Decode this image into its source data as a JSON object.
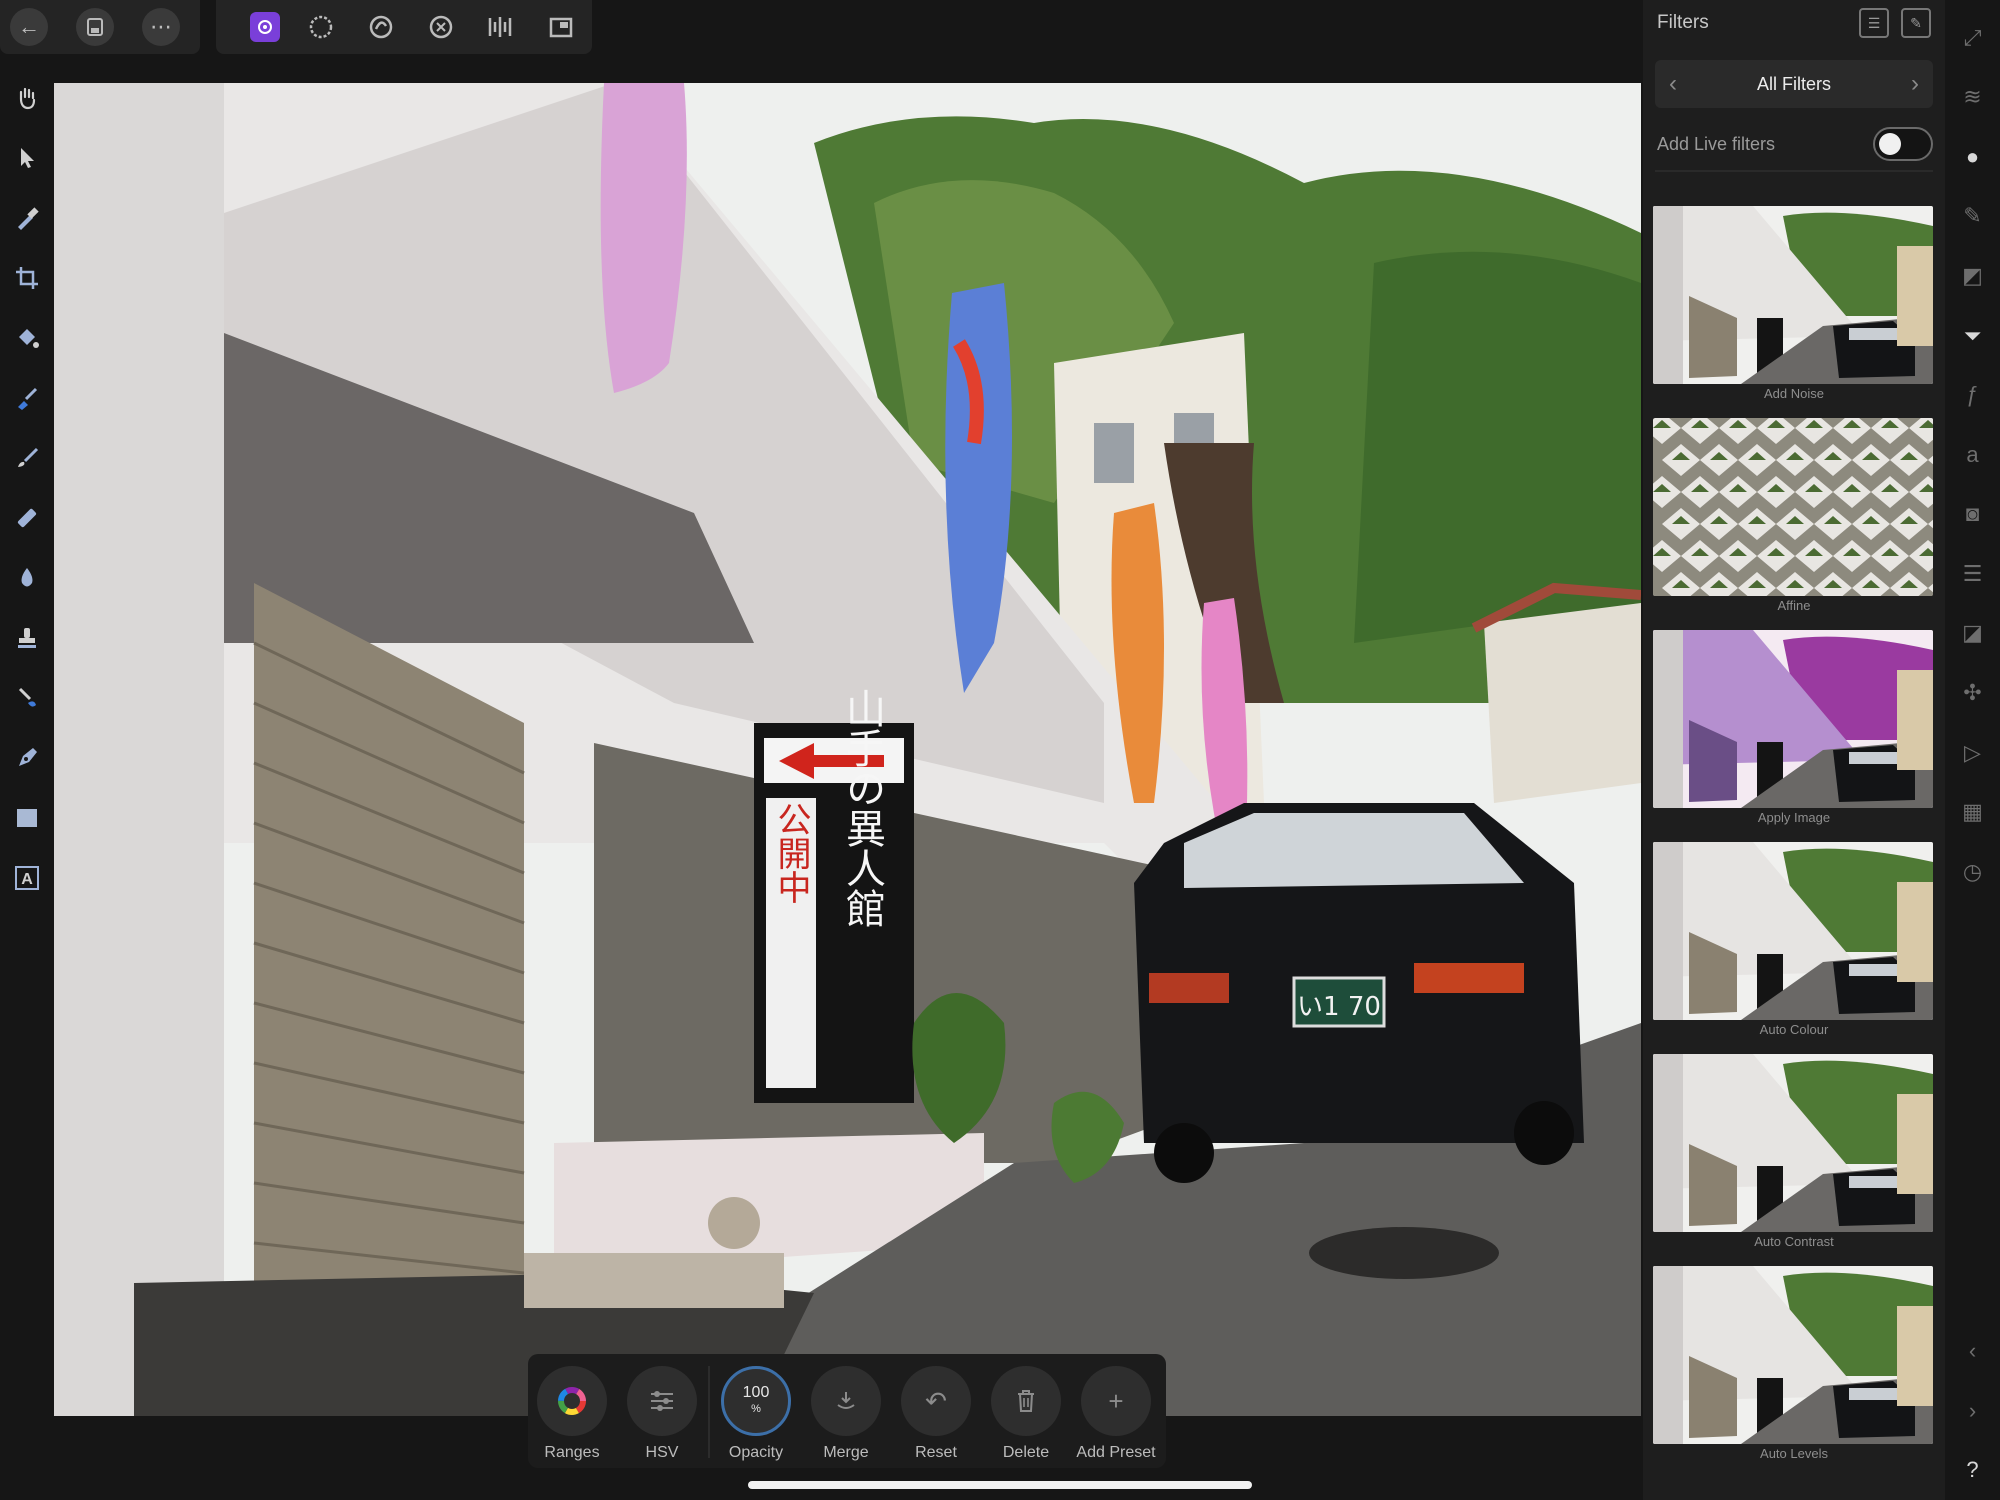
{
  "top_toolbar": {
    "left": [
      {
        "icon": "back-icon",
        "glyph": "←"
      },
      {
        "icon": "document-icon",
        "glyph": "▢"
      },
      {
        "icon": "more-icon",
        "glyph": "⋯"
      }
    ],
    "personas": [
      {
        "icon": "photo-persona-icon",
        "active": true
      },
      {
        "icon": "selection-persona-icon"
      },
      {
        "icon": "liquify-persona-icon"
      },
      {
        "icon": "develop-persona-icon"
      },
      {
        "icon": "tone-mapping-persona-icon"
      },
      {
        "icon": "export-persona-icon"
      }
    ]
  },
  "left_tools": [
    "hand-tool-icon",
    "move-tool-icon",
    "color-picker-tool-icon",
    "crop-tool-icon",
    "flood-fill-tool-icon",
    "selection-brush-tool-icon",
    "paint-brush-tool-icon",
    "erase-brush-tool-icon",
    "burn-tool-icon",
    "clone-tool-icon",
    "smudge-tool-icon",
    "pen-tool-icon",
    "rectangle-tool-icon",
    "text-tool-icon"
  ],
  "context_toolbar": {
    "buttons": [
      {
        "key": "ranges",
        "label": "Ranges",
        "icon": "color-wheel-icon"
      },
      {
        "key": "hsv",
        "label": "HSV",
        "icon": "sliders-icon"
      },
      {
        "key": "opacity",
        "label": "Opacity",
        "value": "100",
        "unit": "%"
      },
      {
        "key": "merge",
        "label": "Merge",
        "icon": "merge-icon"
      },
      {
        "key": "reset",
        "label": "Reset",
        "icon": "undo-icon"
      },
      {
        "key": "delete",
        "label": "Delete",
        "icon": "trash-icon"
      },
      {
        "key": "add_preset",
        "label": "Add Preset",
        "icon": "plus-icon"
      }
    ]
  },
  "filters_panel": {
    "title": "Filters",
    "nav_title": "All Filters",
    "live_filters_label": "Add Live filters",
    "live_filters_on": false,
    "items": [
      {
        "name": "Add Noise"
      },
      {
        "name": "Affine"
      },
      {
        "name": "Apply Image"
      },
      {
        "name": "Auto Colour"
      },
      {
        "name": "Auto Contrast"
      },
      {
        "name": "Auto Levels"
      }
    ]
  },
  "studio_strip": [
    "navigator-icon",
    "layers-icon",
    "color-icon",
    "brushes-icon",
    "adjustments-icon",
    "filters-icon",
    "effects-icon",
    "character-icon",
    "snapshots-icon",
    "transform-icon",
    "channels-icon",
    "macro-icon",
    "play-icon",
    "stock-icon",
    "history-icon",
    "collapse-left-icon",
    "collapse-right-icon",
    "help-icon"
  ],
  "canvas": {
    "sign_text": "山手の異人館",
    "sign_status": "公開中",
    "plate_text": "い1 70"
  },
  "colors": {
    "accent_purple": "#7a3fd9",
    "accent_blue": "#3c6fa8",
    "panel_bg": "#1e1e1e"
  }
}
